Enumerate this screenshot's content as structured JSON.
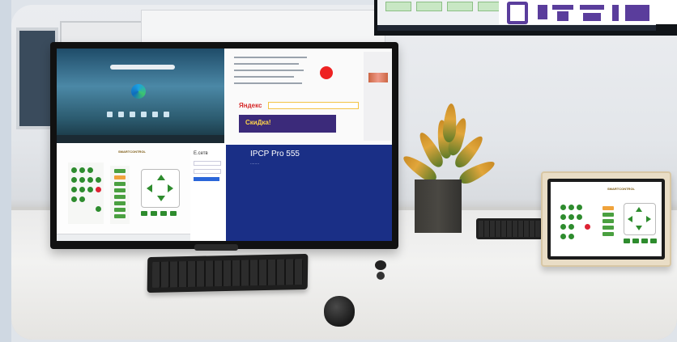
{
  "scene": {
    "description_tags": [
      "monitor",
      "keyboard",
      "mouse",
      "plant",
      "tablet-controller",
      "wall-tv"
    ]
  },
  "monitor": {
    "quadrant_browser": {
      "yandex_logo": "Яндекс",
      "banner_text": "СкиДка!"
    },
    "quadrant_login": {
      "title": "Е.сетв",
      "product": "IPCP Pro 555",
      "subtitle": "........"
    },
    "quadrant_control": {
      "brand": "SMARTCONTROL"
    }
  },
  "tablet": {
    "brand": "SMARTCONTROL"
  },
  "colors": {
    "control_green": "#2e8c2e",
    "accent_orange": "#f0a33b",
    "remote_red": "#d23",
    "login_blue": "#1a2f86",
    "logo_purple": "#5a3d9c"
  }
}
